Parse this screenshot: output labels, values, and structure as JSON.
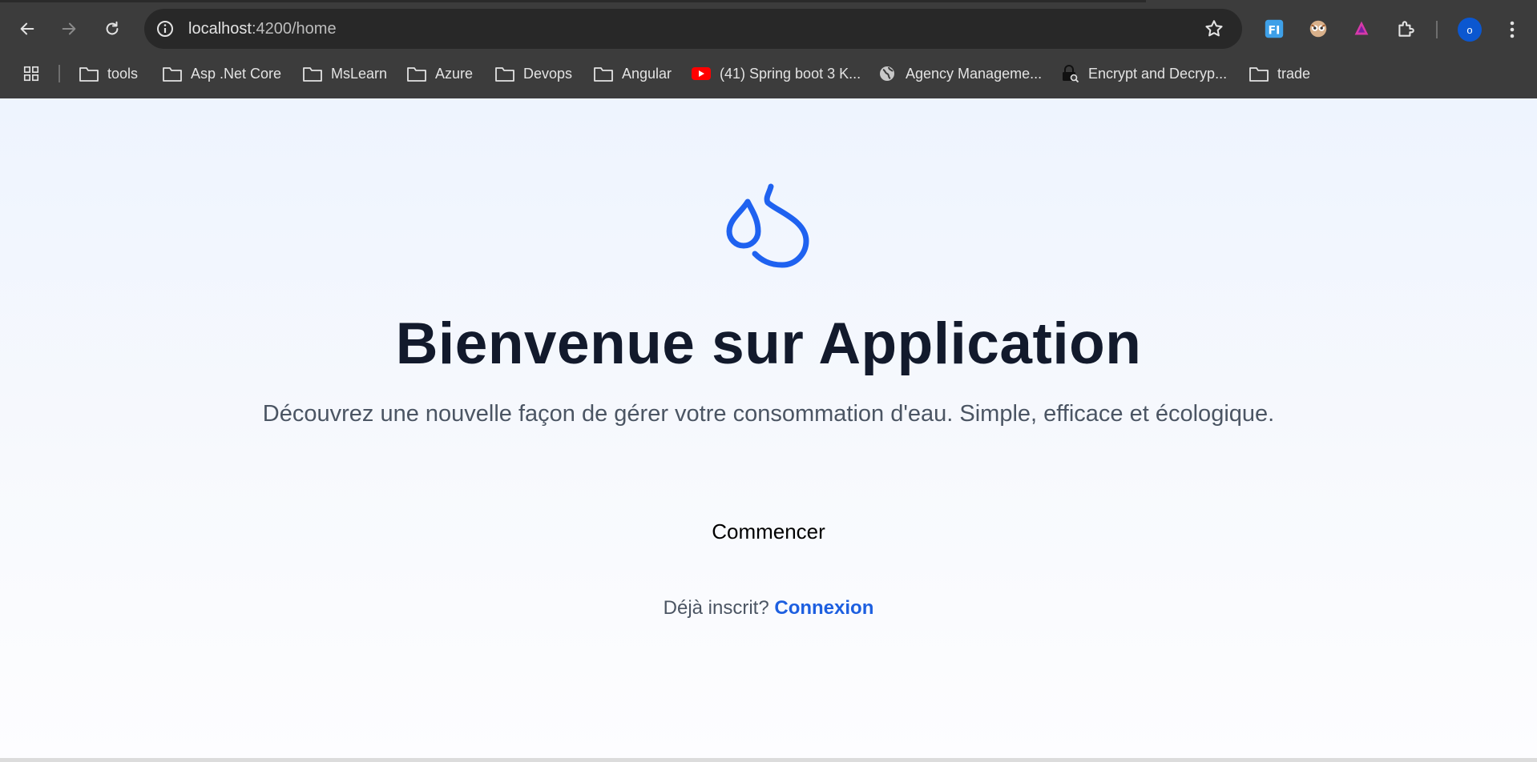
{
  "browser": {
    "url_host": "localhost",
    "url_path": ":4200/home",
    "bookmarks": [
      {
        "label": "tools",
        "icon": "folder-icon"
      },
      {
        "label": "Asp .Net Core",
        "icon": "folder-icon"
      },
      {
        "label": "MsLearn",
        "icon": "folder-icon"
      },
      {
        "label": "Azure",
        "icon": "folder-icon"
      },
      {
        "label": "Devops",
        "icon": "folder-icon"
      },
      {
        "label": "Angular",
        "icon": "folder-icon"
      },
      {
        "label": "(41) Spring boot 3 K...",
        "icon": "youtube-icon"
      },
      {
        "label": "Agency Manageme...",
        "icon": "globe-icon"
      },
      {
        "label": "Encrypt and Decryp...",
        "icon": "lock-search-icon"
      },
      {
        "label": "trade",
        "icon": "folder-icon"
      }
    ],
    "profile_initial": "o"
  },
  "page": {
    "title": "Bienvenue sur Application",
    "subtitle": "Découvrez une nouvelle façon de gérer votre consommation d'eau. Simple, efficace et écologique.",
    "cta_label": "Commencer",
    "login_prompt": "Déjà inscrit?",
    "login_link": "Connexion"
  },
  "colors": {
    "accent": "#1d5fe0",
    "logo": "#1f62f0",
    "title": "#121a2c",
    "text_muted": "#4b5563",
    "chrome_bg": "#3c3c3c"
  }
}
